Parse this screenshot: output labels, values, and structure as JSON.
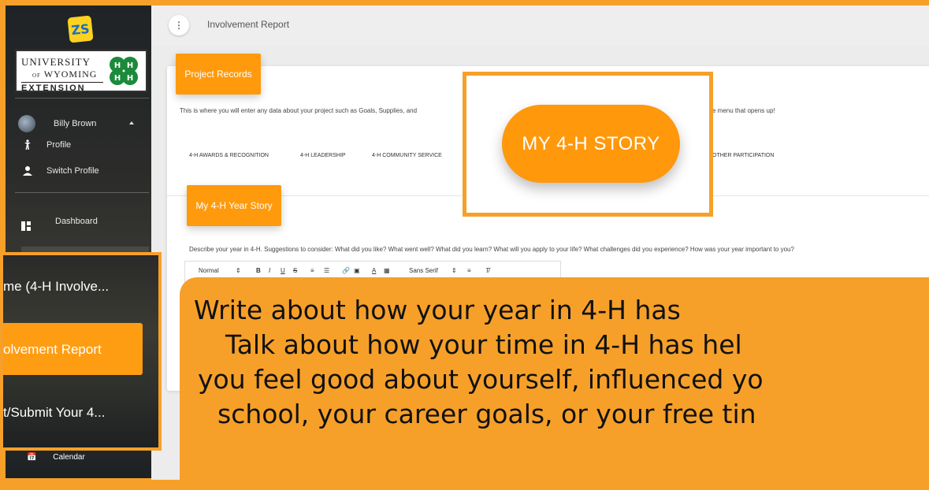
{
  "sidebar": {
    "logo_text": "ZS",
    "uw_logo": {
      "line1": "UNIVERSITY",
      "line2": "WYOMING",
      "line2_prefix": "OF",
      "line3": "EXTENSION"
    },
    "user_name": "Billy Brown",
    "items": [
      {
        "label": "Profile",
        "icon": "person-walking-icon"
      },
      {
        "label": "Switch Profile",
        "icon": "person-icon"
      },
      {
        "label": "Dashboard",
        "icon": "dashboard-icon"
      },
      {
        "label": "Calendar",
        "icon": "calendar-icon"
      }
    ]
  },
  "header": {
    "menu_icon": "vertical-dots-icon",
    "title": "Involvement Report"
  },
  "project_records": {
    "title": "Project Records",
    "description_start": "This is where you will enter any data about your project such as Goals, Supplies, and",
    "description_end": "e menu that opens up!",
    "tabs": [
      "4-H AWARDS & RECOGNITION",
      "4-H LEADERSHIP",
      "4-H COMMUNITY SERVICE",
      "OTHER PARTICIPATION"
    ]
  },
  "year_story": {
    "title": "My 4-H Year Story",
    "prompt": "Describe your year in 4-H. Suggestions to consider: What did you like? What went well? What did you learn? What will you apply to your life? What challenges did you experience? How was your year important to you?",
    "toolbar": {
      "format": "Normal",
      "font": "Sans Serif",
      "buttons": [
        "B",
        "I",
        "U",
        "S"
      ]
    }
  },
  "story_button": {
    "label": "MY 4-H STORY"
  },
  "zoom_menu": {
    "item_above": "me (4-H Involve...",
    "active": "olvement Report",
    "item_below": "t/Submit Your 4..."
  },
  "callout": {
    "lines": [
      "Write about how your year in 4-H has",
      "Talk about how your time in 4-H has hel",
      "you feel good about yourself, influenced yo",
      "school, your career goals, or your free tin"
    ]
  },
  "colors": {
    "accent": "#ff9a0d",
    "frame": "#f6a02a",
    "sidebar": "#25282a"
  }
}
